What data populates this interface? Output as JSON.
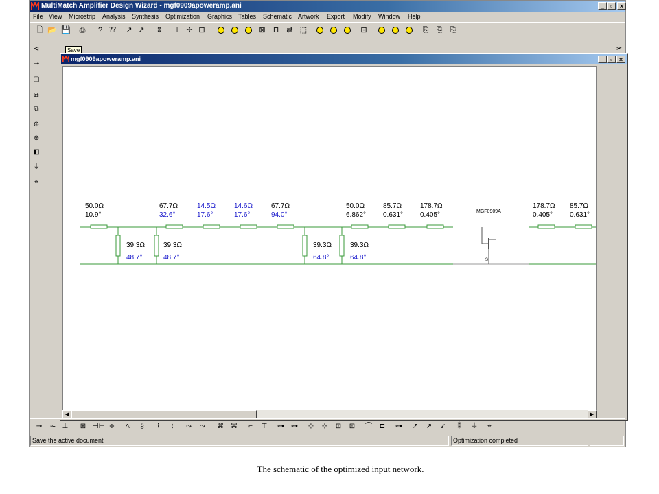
{
  "window": {
    "title": "MultiMatch Amplifier Design Wizard - mgf0909apoweramp.ani"
  },
  "menu": [
    "File",
    "View",
    "Microstrip",
    "Analysis",
    "Synthesis",
    "Optimization",
    "Graphics",
    "Tables",
    "Schematic",
    "Artwork",
    "Export",
    "Modify",
    "Window",
    "Help"
  ],
  "tooltip": "Save",
  "document": {
    "title": "mgf0909apoweramp.ani"
  },
  "schematic": {
    "device_label": "MGF0909A",
    "device_pin": "S",
    "series_lines": [
      {
        "impedance": "50.0Ω",
        "length": "10.9°",
        "highlight": false
      },
      {
        "impedance": "67.7Ω",
        "length": "32.6°",
        "highlight": true
      },
      {
        "impedance": "14.5Ω",
        "length": "17.6°",
        "highlight": true
      },
      {
        "impedance": "14.6Ω",
        "length": "17.6°",
        "highlight": true
      },
      {
        "impedance": "67.7Ω",
        "length": "94.0°",
        "highlight": true
      },
      {
        "impedance": "50.0Ω",
        "length": "6.862°",
        "highlight": false
      },
      {
        "impedance": "85.7Ω",
        "length": "0.631°",
        "highlight": false
      },
      {
        "impedance": "178.7Ω",
        "length": "0.405°",
        "highlight": false
      },
      {
        "impedance": "178.7Ω",
        "length": "0.405°",
        "highlight": false
      },
      {
        "impedance": "85.7Ω",
        "length": "0.631°",
        "highlight": false
      }
    ],
    "stubs": [
      {
        "impedance": "39.3Ω",
        "length": "48.7°"
      },
      {
        "impedance": "39.3Ω",
        "length": "48.7°"
      },
      {
        "impedance": "39.3Ω",
        "length": "64.8°"
      },
      {
        "impedance": "39.3Ω",
        "length": "64.8°"
      }
    ],
    "colors": {
      "line": "#3a9a3a",
      "highlight_text": "#1a1acc",
      "text": "#000000"
    }
  },
  "status": {
    "message": "Save the active document",
    "state": "Optimization completed"
  },
  "caption": "The schematic of the optimized input network."
}
